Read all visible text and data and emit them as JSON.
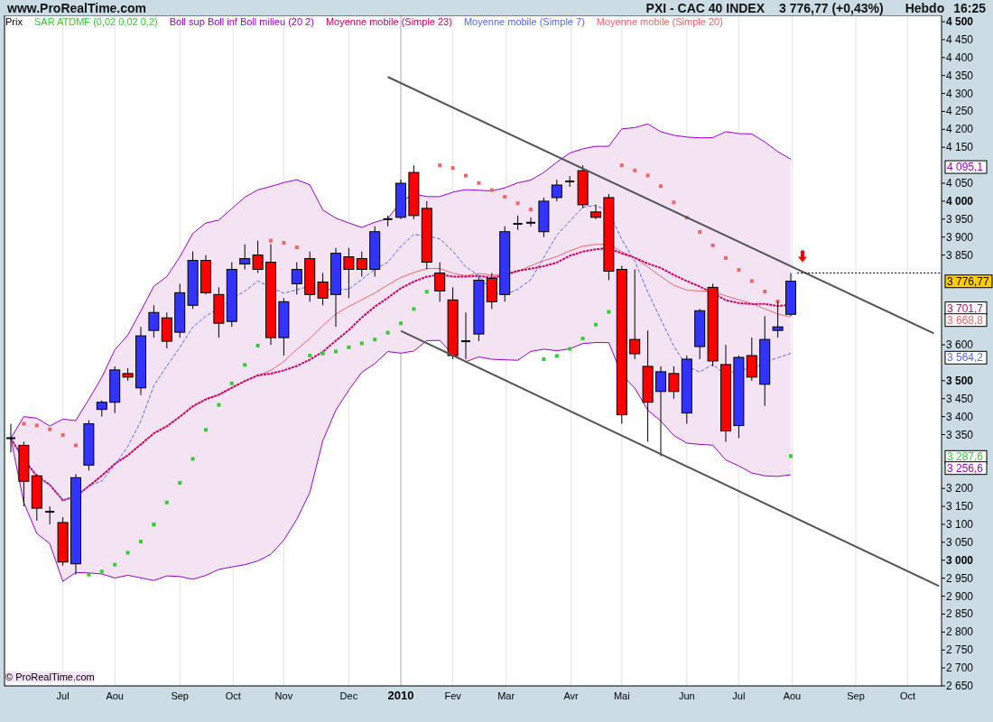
{
  "header": {
    "site": "www.ProRealTime.com",
    "instrument": "PXI - CAC 40 INDEX",
    "quote": "3 776,77 (+0,43%)",
    "period": "Hebdo",
    "time": "16:25"
  },
  "legend": [
    {
      "label": "Prix",
      "color": "#000000"
    },
    {
      "label": "SAR ATDMF (0,02 0,02 0,2)",
      "color": "#33cc33"
    },
    {
      "label": "Boll sup Boll inf Boll milieu (20 2)",
      "color": "#9900cc"
    },
    {
      "label": "Moyenne mobile (Simple 23)",
      "color": "#cc0066"
    },
    {
      "label": "Moyenne mobile (Simple 7)",
      "color": "#5566ff"
    },
    {
      "label": "Moyenne mobile (Simple 20)",
      "color": "#ee6666"
    }
  ],
  "copyright": "© ProRealTime.com",
  "x_axis_labels": [
    {
      "label": "Jul",
      "kind": "month"
    },
    {
      "label": "Aou",
      "kind": "month"
    },
    {
      "label": "Sep",
      "kind": "month"
    },
    {
      "label": "Oct",
      "kind": "month"
    },
    {
      "label": "Nov",
      "kind": "month"
    },
    {
      "label": "Dec",
      "kind": "month"
    },
    {
      "label": "2010",
      "kind": "year"
    },
    {
      "label": "Fev",
      "kind": "month"
    },
    {
      "label": "Mar",
      "kind": "month"
    },
    {
      "label": "Avr",
      "kind": "month"
    },
    {
      "label": "Mai",
      "kind": "month"
    },
    {
      "label": "Jun",
      "kind": "month"
    },
    {
      "label": "Jul",
      "kind": "month"
    },
    {
      "label": "Aou",
      "kind": "month"
    },
    {
      "label": "Sep",
      "kind": "month"
    },
    {
      "label": "Oct",
      "kind": "month"
    }
  ],
  "y_axis_labels": [
    "4 500",
    "4 450",
    "4 400",
    "4 350",
    "4 300",
    "4 250",
    "4 200",
    "4 150",
    "4 050",
    "4 000",
    "3 950",
    "3 900",
    "3 850",
    "3 600",
    "3 500",
    "3 450",
    "3 400",
    "3 350",
    "3 200",
    "3 150",
    "3 100",
    "3 050",
    "3 000",
    "2 950",
    "2 900",
    "2 850",
    "2 800",
    "2 750",
    "2 700",
    "2 650"
  ],
  "value_tags": [
    {
      "label": "4 095,1",
      "color": "#9900cc",
      "kind": "indicator"
    },
    {
      "label": "3 776,77",
      "kind": "price"
    },
    {
      "label": "3 701,7",
      "color": "#cc0066",
      "kind": "indicator"
    },
    {
      "label": "3 668,8",
      "color": "#ee6666",
      "kind": "indicator"
    },
    {
      "label": "3 564,2",
      "color": "#5566ff",
      "kind": "indicator"
    },
    {
      "label": "3 287,6",
      "color": "#33cc33",
      "kind": "indicator"
    },
    {
      "label": "3 256,6",
      "color": "#9900cc",
      "kind": "indicator"
    }
  ]
}
